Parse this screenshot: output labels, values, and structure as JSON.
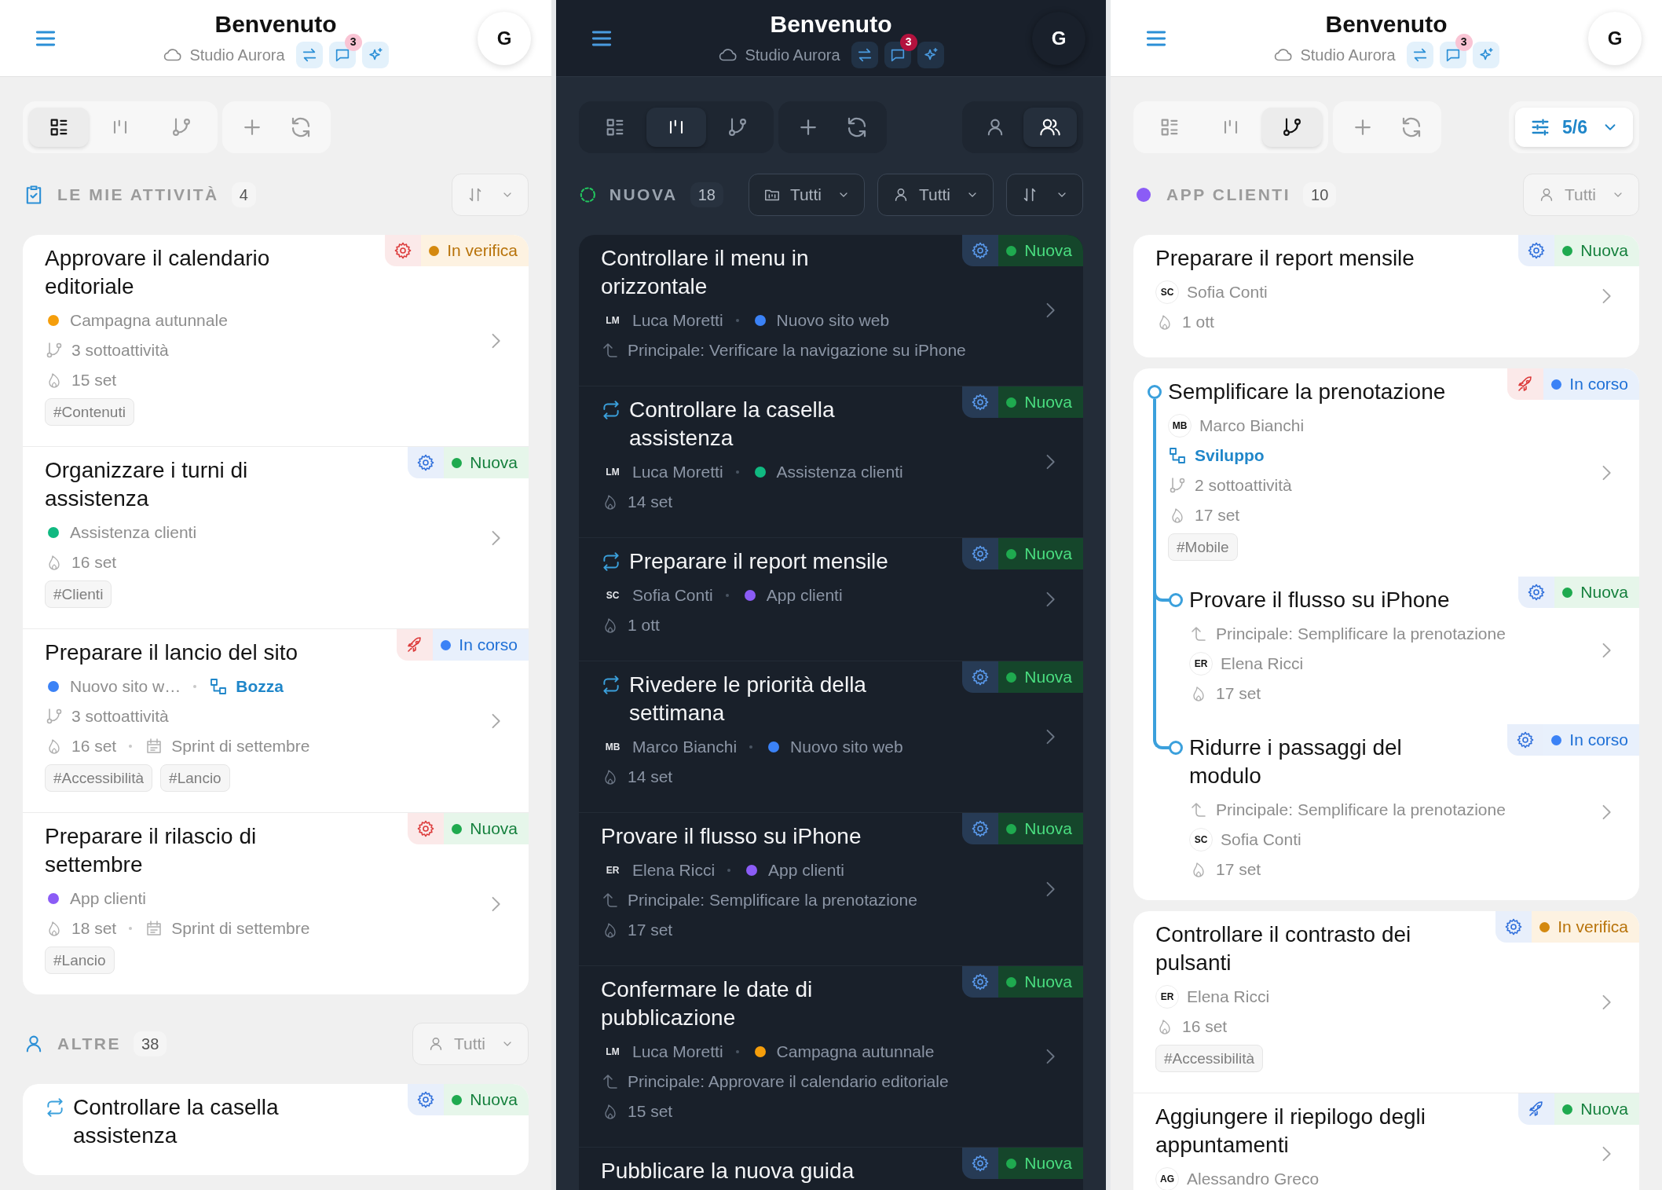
{
  "panels": [
    {
      "kind": "light",
      "header": {
        "title": "Benvenuto",
        "workspace": "Studio Aurora",
        "notification_count": "3",
        "avatar": "G"
      },
      "toolbar": {
        "views": [
          {
            "kind": "list",
            "selected": true
          },
          {
            "kind": "board",
            "selected": false
          },
          {
            "kind": "tree",
            "selected": false
          }
        ]
      },
      "sections": [
        {
          "kind": "mine",
          "title": "LE MIE ATTIVITÀ",
          "count": "4",
          "filters": [
            {
              "kind": "sort"
            }
          ],
          "groups": [
            {
              "cards": [
                {
                  "title": "Approvare il calendario editoriale",
                  "badge": {
                    "kind": "review",
                    "label": "In verifica",
                    "category": {
                      "kind": "gear",
                      "color": "#dc3b3b"
                    }
                  },
                  "lines": [
                    {
                      "items": [
                        {
                          "kind": "project",
                          "label": "Campagna autunnale",
                          "color": "#f59e0b"
                        }
                      ]
                    },
                    {
                      "items": [
                        {
                          "kind": "subtasks",
                          "label": "3 sottoattività"
                        }
                      ]
                    },
                    {
                      "items": [
                        {
                          "kind": "due",
                          "label": "15 set"
                        }
                      ]
                    }
                  ],
                  "tags": [
                    "#Contenuti"
                  ]
                },
                {
                  "title": "Organizzare i turni di assistenza",
                  "badge": {
                    "kind": "new",
                    "label": "Nuova",
                    "category": {
                      "kind": "gear",
                      "color": "#2f6fdb"
                    }
                  },
                  "lines": [
                    {
                      "items": [
                        {
                          "kind": "project",
                          "label": "Assistenza clienti",
                          "color": "#10b981"
                        }
                      ]
                    },
                    {
                      "items": [
                        {
                          "kind": "due",
                          "label": "16 set"
                        }
                      ]
                    }
                  ],
                  "tags": [
                    "#Clienti"
                  ]
                },
                {
                  "title": "Preparare il lancio del sito",
                  "badge": {
                    "kind": "progress",
                    "label": "In corso",
                    "category": {
                      "kind": "rocket",
                      "color": "#dc3b3b"
                    }
                  },
                  "lines": [
                    {
                      "items": [
                        {
                          "kind": "project",
                          "label": "Nuovo sito w…",
                          "color": "#3b82f6"
                        },
                        {
                          "kind": "workflow",
                          "label": "Bozza"
                        }
                      ]
                    },
                    {
                      "items": [
                        {
                          "kind": "subtasks",
                          "label": "3 sottoattività"
                        }
                      ]
                    },
                    {
                      "items": [
                        {
                          "kind": "due",
                          "label": "16 set"
                        },
                        {
                          "kind": "sprint",
                          "label": "Sprint di settembre"
                        }
                      ]
                    }
                  ],
                  "tags": [
                    "#Accessibilità",
                    "#Lancio"
                  ]
                },
                {
                  "title": "Preparare il rilascio di settembre",
                  "badge": {
                    "kind": "new",
                    "label": "Nuova",
                    "category": {
                      "kind": "gear",
                      "color": "#dc3b3b"
                    }
                  },
                  "lines": [
                    {
                      "items": [
                        {
                          "kind": "project",
                          "label": "App clienti",
                          "color": "#8b5cf6"
                        }
                      ]
                    },
                    {
                      "items": [
                        {
                          "kind": "due",
                          "label": "18 set"
                        },
                        {
                          "kind": "sprint",
                          "label": "Sprint di settembre"
                        }
                      ]
                    }
                  ],
                  "tags": [
                    "#Lancio"
                  ]
                }
              ]
            }
          ]
        },
        {
          "kind": "others",
          "title": "ALTRE",
          "count": "38",
          "filters": [
            {
              "kind": "assignee",
              "label": "Tutti"
            }
          ],
          "groups": [
            {
              "cards": [
                {
                  "title": "Controllare la casella assistenza",
                  "recurring": true,
                  "badge": {
                    "kind": "new",
                    "label": "Nuova",
                    "category": {
                      "kind": "gear",
                      "color": "#2f6fdb"
                    }
                  }
                }
              ]
            }
          ]
        }
      ]
    },
    {
      "kind": "dark",
      "header": {
        "title": "Benvenuto",
        "workspace": "Studio Aurora",
        "notification_count": "3",
        "avatar": "G"
      },
      "toolbar": {
        "views": [
          {
            "kind": "list",
            "selected": false
          },
          {
            "kind": "board",
            "selected": true
          },
          {
            "kind": "tree",
            "selected": false
          }
        ],
        "extra": {
          "kind": "assignee_toggle",
          "options": [
            {
              "kind": "person",
              "selected": false
            },
            {
              "kind": "people",
              "selected": true
            }
          ]
        }
      },
      "sections": [
        {
          "kind": "status",
          "title": "NUOVA",
          "count": "18",
          "filters": [
            {
              "kind": "project",
              "label": "Tutti"
            },
            {
              "kind": "assignee",
              "label": "Tutti"
            },
            {
              "kind": "sort"
            }
          ],
          "groups": [
            {
              "cards": [
                {
                  "title": "Controllare il menu in orizzontale",
                  "badge": {
                    "kind": "new",
                    "label": "Nuova",
                    "category": {
                      "kind": "gear",
                      "color": "#5b9cf0"
                    }
                  },
                  "lines": [
                    {
                      "items": [
                        {
                          "kind": "assignee",
                          "initials": "LM",
                          "name": "Luca Moretti"
                        },
                        {
                          "kind": "project",
                          "label": "Nuovo sito web",
                          "color": "#3b82f6"
                        }
                      ]
                    },
                    {
                      "items": [
                        {
                          "kind": "parent",
                          "label": "Principale: Verificare la navigazione su iPhone"
                        }
                      ]
                    }
                  ]
                },
                {
                  "title": "Controllare la casella assistenza",
                  "recurring": true,
                  "badge": {
                    "kind": "new",
                    "label": "Nuova",
                    "category": {
                      "kind": "gear",
                      "color": "#5b9cf0"
                    }
                  },
                  "lines": [
                    {
                      "items": [
                        {
                          "kind": "assignee",
                          "initials": "LM",
                          "name": "Luca Moretti"
                        },
                        {
                          "kind": "project",
                          "label": "Assistenza clienti",
                          "color": "#10b981"
                        }
                      ]
                    },
                    {
                      "items": [
                        {
                          "kind": "due",
                          "label": "14 set"
                        }
                      ]
                    }
                  ]
                },
                {
                  "title": "Preparare il report mensile",
                  "recurring": true,
                  "badge": {
                    "kind": "new",
                    "label": "Nuova",
                    "category": {
                      "kind": "gear",
                      "color": "#5b9cf0"
                    }
                  },
                  "lines": [
                    {
                      "items": [
                        {
                          "kind": "assignee",
                          "initials": "SC",
                          "name": "Sofia Conti"
                        },
                        {
                          "kind": "project",
                          "label": "App clienti",
                          "color": "#8b5cf6"
                        }
                      ]
                    },
                    {
                      "items": [
                        {
                          "kind": "due",
                          "label": "1 ott"
                        }
                      ]
                    }
                  ]
                },
                {
                  "title": "Rivedere le priorità della settimana",
                  "recurring": true,
                  "badge": {
                    "kind": "new",
                    "label": "Nuova",
                    "category": {
                      "kind": "gear",
                      "color": "#5b9cf0"
                    }
                  },
                  "lines": [
                    {
                      "items": [
                        {
                          "kind": "assignee",
                          "initials": "MB",
                          "name": "Marco Bianchi"
                        },
                        {
                          "kind": "project",
                          "label": "Nuovo sito web",
                          "color": "#3b82f6"
                        }
                      ]
                    },
                    {
                      "items": [
                        {
                          "kind": "due",
                          "label": "14 set"
                        }
                      ]
                    }
                  ]
                },
                {
                  "title": "Provare il flusso su iPhone",
                  "badge": {
                    "kind": "new",
                    "label": "Nuova",
                    "category": {
                      "kind": "gear",
                      "color": "#5b9cf0"
                    }
                  },
                  "lines": [
                    {
                      "items": [
                        {
                          "kind": "assignee",
                          "initials": "ER",
                          "name": "Elena Ricci"
                        },
                        {
                          "kind": "project",
                          "label": "App clienti",
                          "color": "#8b5cf6"
                        }
                      ]
                    },
                    {
                      "items": [
                        {
                          "kind": "parent",
                          "label": "Principale: Semplificare la prenotazione"
                        }
                      ]
                    },
                    {
                      "items": [
                        {
                          "kind": "due",
                          "label": "17 set"
                        }
                      ]
                    }
                  ]
                },
                {
                  "title": "Confermare le date di pubblicazione",
                  "badge": {
                    "kind": "new",
                    "label": "Nuova",
                    "category": {
                      "kind": "gear",
                      "color": "#5b9cf0"
                    }
                  },
                  "lines": [
                    {
                      "items": [
                        {
                          "kind": "assignee",
                          "initials": "LM",
                          "name": "Luca Moretti"
                        },
                        {
                          "kind": "project",
                          "label": "Campagna autunnale",
                          "color": "#f59e0b"
                        }
                      ]
                    },
                    {
                      "items": [
                        {
                          "kind": "parent",
                          "label": "Principale: Approvare il calendario editoriale"
                        }
                      ]
                    },
                    {
                      "items": [
                        {
                          "kind": "due",
                          "label": "15 set"
                        }
                      ]
                    }
                  ]
                },
                {
                  "title": "Pubblicare la nuova guida",
                  "badge": {
                    "kind": "new",
                    "label": "Nuova",
                    "category": {
                      "kind": "gear",
                      "color": "#5b9cf0"
                    }
                  }
                }
              ]
            }
          ]
        }
      ]
    },
    {
      "kind": "light",
      "header": {
        "title": "Benvenuto",
        "workspace": "Studio Aurora",
        "notification_count": "3",
        "avatar": "G"
      },
      "toolbar": {
        "views": [
          {
            "kind": "list",
            "selected": false
          },
          {
            "kind": "board",
            "selected": false
          },
          {
            "kind": "tree",
            "selected": true
          }
        ],
        "extra": {
          "kind": "filter",
          "label": "5/6"
        }
      },
      "sections": [
        {
          "kind": "project",
          "color": "#8b5cf6",
          "title": "APP CLIENTI",
          "count": "10",
          "filters": [
            {
              "kind": "assignee",
              "label": "Tutti"
            }
          ],
          "groups": [
            {
              "cards": [
                {
                  "title": "Preparare il report mensile",
                  "badge": {
                    "kind": "new",
                    "label": "Nuova",
                    "category": {
                      "kind": "gear",
                      "color": "#2f6fdb"
                    }
                  },
                  "lines": [
                    {
                      "items": [
                        {
                          "kind": "assignee",
                          "initials": "SC",
                          "name": "Sofia Conti"
                        }
                      ]
                    },
                    {
                      "items": [
                        {
                          "kind": "due",
                          "label": "1 ott"
                        }
                      ]
                    }
                  ]
                }
              ]
            },
            {
              "cards": [
                {
                  "title": "Semplificare la prenotazione",
                  "badge": {
                    "kind": "progress",
                    "label": "In corso",
                    "category": {
                      "kind": "rocket",
                      "color": "#dc3b3b"
                    }
                  },
                  "lines": [
                    {
                      "items": [
                        {
                          "kind": "assignee",
                          "initials": "MB",
                          "name": "Marco Bianchi"
                        }
                      ]
                    },
                    {
                      "items": [
                        {
                          "kind": "workflow",
                          "label": "Sviluppo"
                        }
                      ]
                    },
                    {
                      "items": [
                        {
                          "kind": "subtasks",
                          "label": "2 sottoattività"
                        }
                      ]
                    },
                    {
                      "items": [
                        {
                          "kind": "due",
                          "label": "17 set"
                        }
                      ]
                    }
                  ],
                  "tags": [
                    "#Mobile"
                  ],
                  "children": [
                    {
                      "title": "Provare il flusso su iPhone",
                      "badge": {
                        "kind": "new",
                        "label": "Nuova",
                        "category": {
                          "kind": "gear",
                          "color": "#2f6fdb"
                        }
                      },
                      "lines": [
                        {
                          "items": [
                            {
                              "kind": "parent",
                              "label": "Principale: Semplificare la prenotazione"
                            }
                          ]
                        },
                        {
                          "items": [
                            {
                              "kind": "assignee",
                              "initials": "ER",
                              "name": "Elena Ricci"
                            }
                          ]
                        },
                        {
                          "items": [
                            {
                              "kind": "due",
                              "label": "17 set"
                            }
                          ]
                        }
                      ]
                    },
                    {
                      "title": "Ridurre i passaggi del modulo",
                      "badge": {
                        "kind": "progress",
                        "label": "In corso",
                        "category": {
                          "kind": "gear",
                          "color": "#2f6fdb"
                        }
                      },
                      "lines": [
                        {
                          "items": [
                            {
                              "kind": "parent",
                              "label": "Principale: Semplificare la prenotazione"
                            }
                          ]
                        },
                        {
                          "items": [
                            {
                              "kind": "assignee",
                              "initials": "SC",
                              "name": "Sofia Conti"
                            }
                          ]
                        },
                        {
                          "items": [
                            {
                              "kind": "due",
                              "label": "17 set"
                            }
                          ]
                        }
                      ]
                    }
                  ]
                }
              ]
            },
            {
              "cards": [
                {
                  "title": "Controllare il contrasto dei pulsanti",
                  "badge": {
                    "kind": "review",
                    "label": "In verifica",
                    "category": {
                      "kind": "gear",
                      "color": "#2f6fdb"
                    }
                  },
                  "lines": [
                    {
                      "items": [
                        {
                          "kind": "assignee",
                          "initials": "ER",
                          "name": "Elena Ricci"
                        }
                      ]
                    },
                    {
                      "items": [
                        {
                          "kind": "due",
                          "label": "16 set"
                        }
                      ]
                    }
                  ],
                  "tags": [
                    "#Accessibilità"
                  ]
                },
                {
                  "title": "Aggiungere il riepilogo degli appuntamenti",
                  "badge": {
                    "kind": "new",
                    "label": "Nuova",
                    "category": {
                      "kind": "rocket",
                      "color": "#2f6fdb"
                    }
                  },
                  "lines": [
                    {
                      "items": [
                        {
                          "kind": "assignee",
                          "initials": "AG",
                          "name": "Alessandro Greco"
                        }
                      ]
                    }
                  ]
                }
              ]
            }
          ]
        }
      ]
    }
  ]
}
